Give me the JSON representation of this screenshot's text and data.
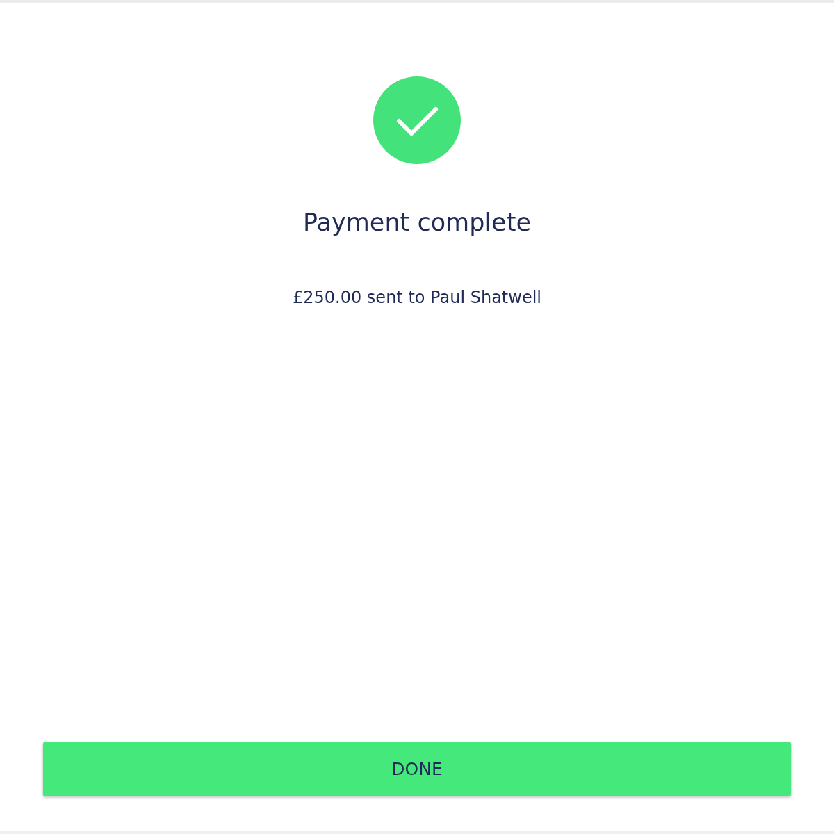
{
  "status": {
    "kind": "success"
  },
  "title": "Payment complete",
  "message": "£250.00 sent to Paul Shatwell",
  "button": {
    "label": "DONE"
  }
}
